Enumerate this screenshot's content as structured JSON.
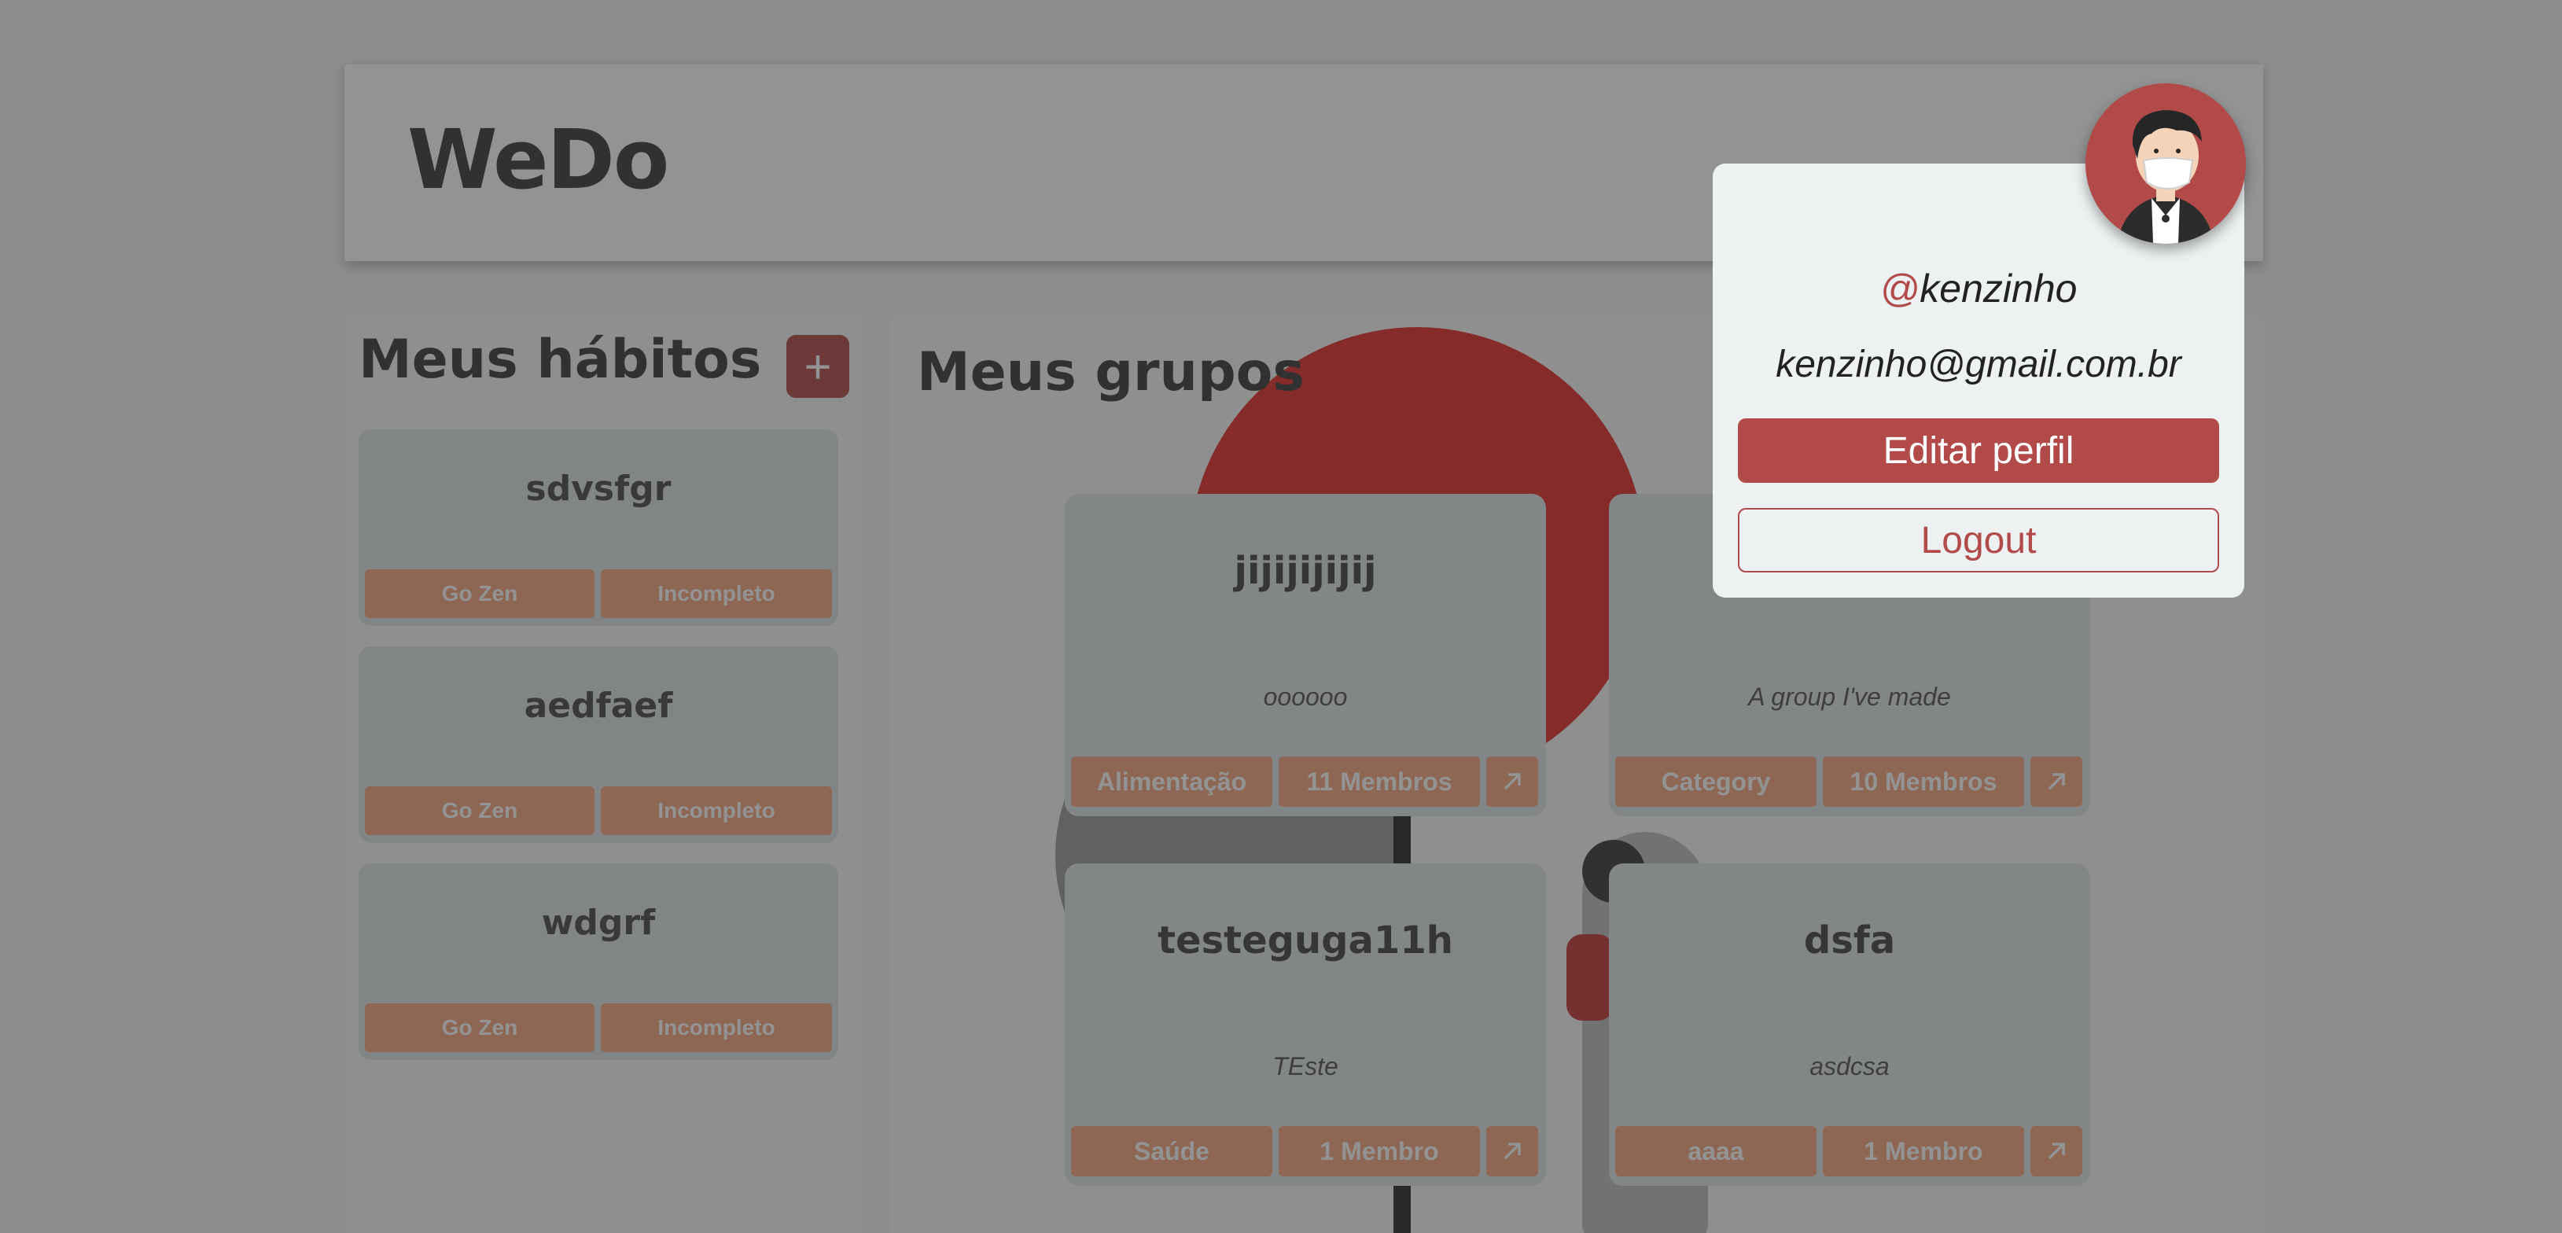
{
  "header": {
    "logo": "WeDo"
  },
  "habits": {
    "title": "Meus hábitos",
    "add_label": "+",
    "items": [
      {
        "name": "sdvsfgr",
        "category": "Go Zen",
        "status": "Incompleto"
      },
      {
        "name": "aedfaef",
        "category": "Go Zen",
        "status": "Incompleto"
      },
      {
        "name": "wdgrf",
        "category": "Go Zen",
        "status": "Incompleto"
      }
    ]
  },
  "groups": {
    "title": "Meus grupos",
    "items": [
      {
        "name": "jijijijijij",
        "description": "oooooo",
        "category": "Alimentação",
        "members": "11 Membros"
      },
      {
        "name": "",
        "description": "A group I've made",
        "category": "Category",
        "members": "10 Membros"
      },
      {
        "name": "testeguga11h",
        "description": "TEste",
        "category": "Saúde",
        "members": "1 Membro"
      },
      {
        "name": "dsfa",
        "description": "asdcsa",
        "category": "aaaa",
        "members": "1 Membro"
      }
    ]
  },
  "profile_popup": {
    "at_symbol": "@",
    "username": "kenzinho",
    "email": "kenzinho@gmail.com.br",
    "edit_label": "Editar perfil",
    "logout_label": "Logout"
  },
  "colors": {
    "accent": "#b24a4a",
    "tag": "#f3a67e",
    "card": "#dfe4e6"
  }
}
